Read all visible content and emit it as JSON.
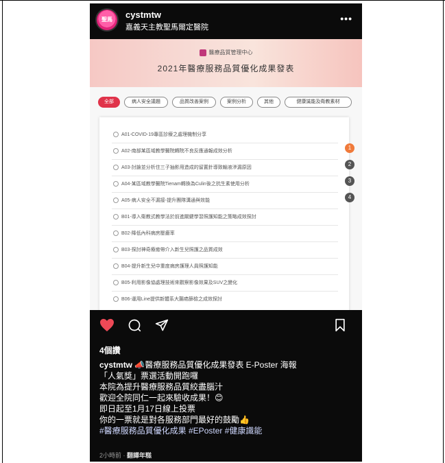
{
  "header": {
    "username": "cystmtw",
    "subtitle": "嘉義天主教聖馬爾定醫院",
    "more": "•••",
    "avatar_text": "聖馬"
  },
  "post": {
    "org": "醫療品質管理中心",
    "title": "2021年醫療服務品質優化成果發表",
    "tabs": [
      "全部",
      "病人安全議題",
      "品質改善案例",
      "案例分析",
      "其他",
      "健康識能及衛教素材"
    ],
    "items": [
      "A01-COVID-19專區診療之處理機制分享",
      "A02-南部某區域教學醫院轉院不良反應通報成效分析",
      "A03-討論並分析住三子抽影用造成的留置針導致輸液滲漏原因",
      "A04-某區域教學醫院Tienam轉換為Culin後之抗生素使用分析",
      "A05-病人安全不漏接-提升團隊溝通與效能",
      "B01-導入衛教式教學法於前進關鍵學習照護知能之策略成效探討",
      "B02-降低內科病房壓瘡率",
      "B03-探討神奇療癒帶介入新生兒照護之品質成效",
      "B04-提升新生兒中重度病房護理人員照護知能",
      "B05-利用影像協處理技術來觀察影像效果及SUV之變化",
      "B06-運用Line提供新體系大腸癌篩檢之成效探討"
    ],
    "pager": [
      "1",
      "2",
      "3",
      "4"
    ]
  },
  "engagement": {
    "likes": "4個讚",
    "caption_user": "cystmtw",
    "caption_lines": [
      "📣醫療服務品質優化成果發表 E-Poster 海報",
      "「人氣獎」票選活動開跑囉",
      "本院為提升醫療服務品質絞盡腦汁",
      "歡迎全院同仁一起來驗收成果！😊",
      "即日起至1月17日線上投票",
      "你的一票就是對各服務部門最好的鼓勵👍"
    ],
    "hashtags": "#醫療服務品質優化成果 #EPoster #健康識能",
    "time": "2小時前",
    "translate": "翻譯年糕"
  },
  "colors": {
    "like_red": "#ed4956",
    "tab_active": "#e0334a",
    "pager_active": "#f07a3a",
    "pager_inactive": "#555555"
  },
  "icons": [
    "heart-icon",
    "comment-icon",
    "share-icon",
    "bookmark-icon",
    "more-icon"
  ]
}
